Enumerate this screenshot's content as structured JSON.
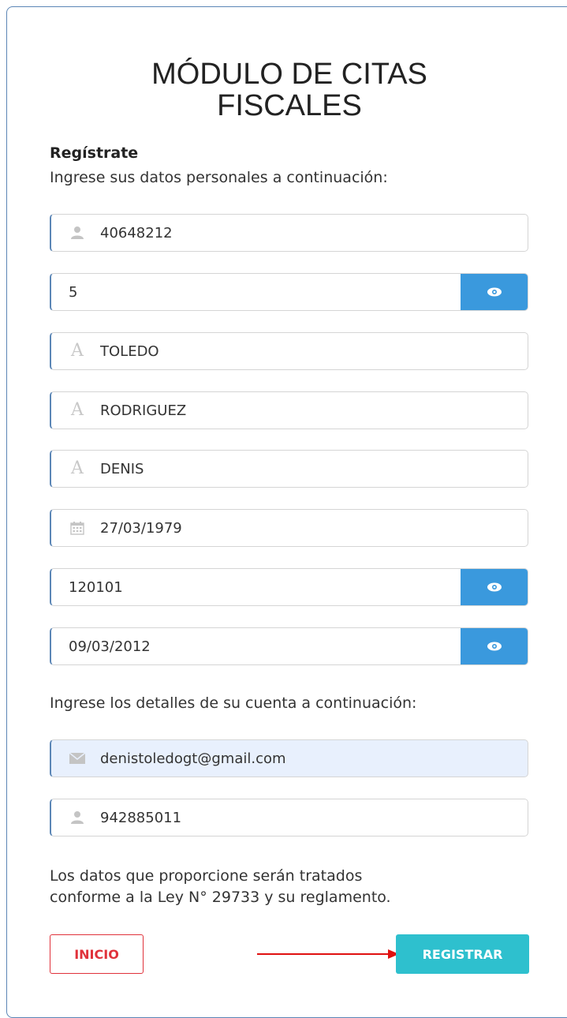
{
  "header": {
    "title_line1": "MÓDULO DE CITAS",
    "title_line2": "FISCALES"
  },
  "register": {
    "heading": "Regístrate",
    "intro": "Ingrese sus datos personales a continuación:"
  },
  "fields": {
    "dni": {
      "value": "40648212",
      "icon": "user-icon"
    },
    "digit": {
      "value": "5",
      "button_icon": "eye-icon"
    },
    "surname1": {
      "value": "TOLEDO",
      "icon": "letter-a-icon"
    },
    "surname2": {
      "value": "RODRIGUEZ",
      "icon": "letter-a-icon"
    },
    "names": {
      "value": "DENIS",
      "icon": "letter-a-icon"
    },
    "birthdate": {
      "value": "27/03/1979",
      "icon": "calendar-icon"
    },
    "ubigeo": {
      "value": "120101",
      "button_icon": "eye-icon"
    },
    "issue_date": {
      "value": "09/03/2012",
      "button_icon": "eye-icon"
    }
  },
  "account": {
    "intro": "Ingrese los detalles de su cuenta a continuación:",
    "email": {
      "value": "denistoledogt@gmail.com",
      "icon": "envelope-icon"
    },
    "phone": {
      "value": "942885011",
      "icon": "user-icon"
    }
  },
  "legal": {
    "line1": "Los datos que proporcione serán tratados",
    "line2": "conforme a la Ley N° 29733 y su reglamento."
  },
  "actions": {
    "inicio_label": "INICIO",
    "registrar_label": "REGISTRAR"
  },
  "colors": {
    "accent_blue": "#3a99dd",
    "teal_button": "#2ec0ce",
    "red_outline": "#e0323b",
    "annotation_arrow": "#e01010"
  }
}
